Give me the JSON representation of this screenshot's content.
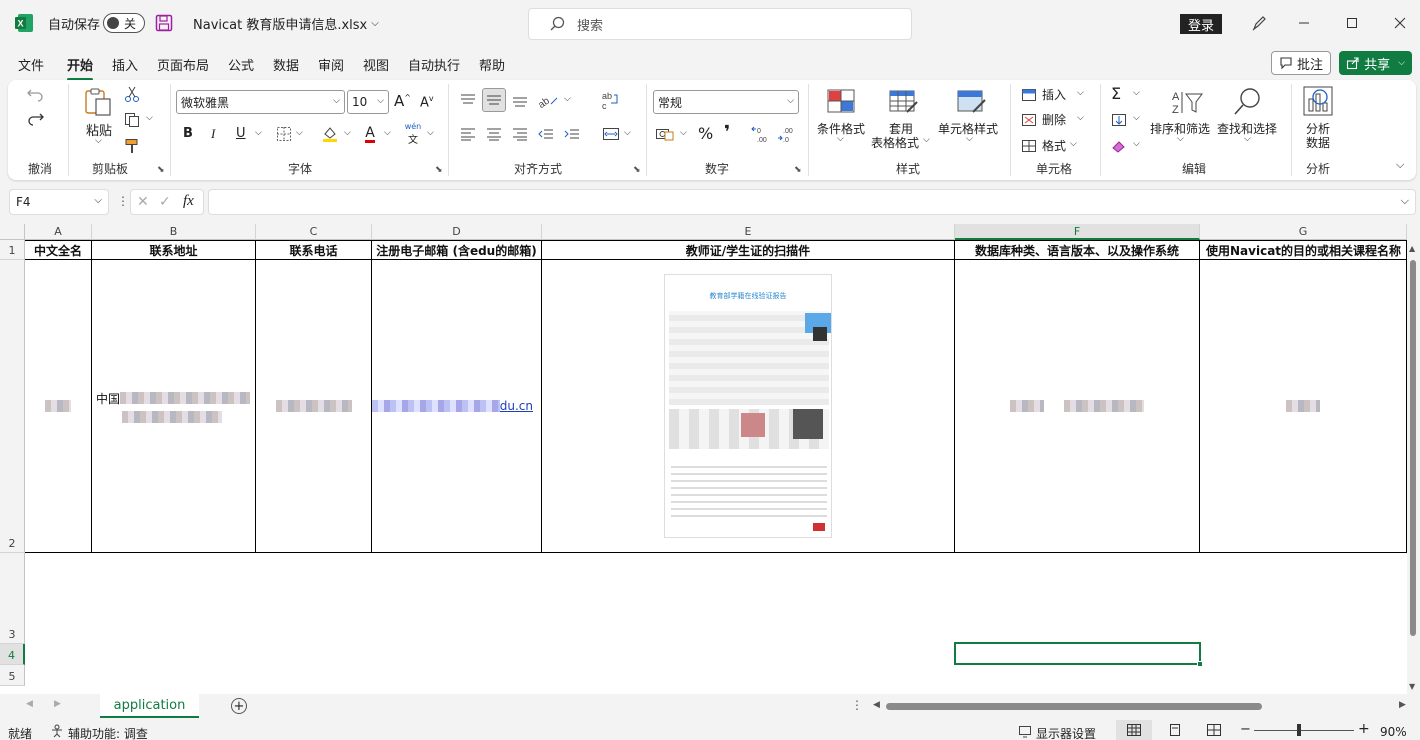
{
  "titlebar": {
    "autosave_label": "自动保存",
    "autosave_state": "关",
    "filename": "Navicat 教育版申请信息.xlsx",
    "search_placeholder": "搜索",
    "login_label": "登录"
  },
  "menu": {
    "items": [
      "文件",
      "开始",
      "插入",
      "页面布局",
      "公式",
      "数据",
      "审阅",
      "视图",
      "自动执行",
      "帮助"
    ],
    "active": "开始",
    "comments_label": "批注",
    "share_label": "共享"
  },
  "ribbon": {
    "groups": {
      "undo": "撤消",
      "clipboard": "剪贴板",
      "font": "字体",
      "alignment": "对齐方式",
      "number": "数字",
      "styles": "样式",
      "cells": "单元格",
      "editing": "编辑",
      "analysis": "分析"
    },
    "paste_label": "粘贴",
    "font_name": "微软雅黑",
    "font_size": "10",
    "number_format": "常规",
    "conditional_format": "条件格式",
    "table_format_1": "套用",
    "table_format_2": "表格格式",
    "cell_styles": "单元格样式",
    "insert": "插入",
    "delete": "删除",
    "format": "格式",
    "sort_filter": "排序和筛选",
    "find_select": "查找和选择",
    "analyze_1": "分析",
    "analyze_2": "数据",
    "bold": "B",
    "italic": "I",
    "underline": "U",
    "percent": "%",
    "comma": "❜",
    "font_color_letter": "A",
    "phonetic": "wén"
  },
  "formula_bar": {
    "cell_ref": "F4",
    "formula": ""
  },
  "sheet": {
    "columns": [
      "A",
      "B",
      "C",
      "D",
      "E",
      "F",
      "G"
    ],
    "selected_column": "F",
    "rows": [
      "1",
      "2",
      "3",
      "4",
      "5"
    ],
    "selected_row": "4",
    "headers": [
      "中文全名",
      "联系地址",
      "联系电话",
      "注册电子邮箱 (含edu的邮箱)",
      "教师证/学生证的扫描件",
      "数据库种类、语言版本、以及操作系统",
      "使用Navicat的目的或相关课程名称"
    ],
    "row2": {
      "address_prefix": "中国",
      "email_suffix": "du.cn"
    },
    "scan_title": "教育部学籍在线验证报告"
  },
  "tabs": {
    "sheet_name": "application"
  },
  "status": {
    "ready": "就绪",
    "accessibility": "辅助功能: 调查",
    "display_settings": "显示器设置",
    "zoom": "90%"
  },
  "colors": {
    "accent": "#107c41",
    "excel_green": "#1d6f42"
  }
}
